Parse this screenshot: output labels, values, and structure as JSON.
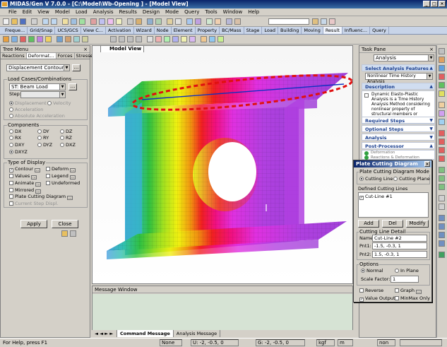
{
  "window": {
    "title": "MIDAS/Gen V 7.0.0 - [C:\\Model\\Wb-Opening ] - [Model View]"
  },
  "menu": [
    "File",
    "Edit",
    "View",
    "Model",
    "Load",
    "Analysis",
    "Results",
    "Design",
    "Mode",
    "Query",
    "Tools",
    "Window",
    "Help"
  ],
  "ribbon_tabs": [
    "Freque...",
    "Grid/Snap",
    "UCS/GCS",
    "View C...",
    "Activation",
    "Wizard",
    "Node",
    "Element",
    "Property",
    "BC/Mass",
    "Stage",
    "Load",
    "Building",
    "Moving",
    "Result",
    "Influenc...",
    "Query"
  ],
  "ribbon_active_tab": "Result",
  "tree_menu": {
    "title": "Tree Menu",
    "tabs": [
      "Reactions",
      "Deformat...",
      "Forces",
      "Stresses"
    ],
    "active_tab": "Deformat...",
    "result_type": "Displacement Contour",
    "load_cases_label": "Load Cases/Combinations",
    "load_case": "ST: Beam Load",
    "step_label": "Step:",
    "displacement": "Displacement",
    "velocity": "Velocity",
    "acceleration": "Acceleration",
    "absolute_acceleration": "Absolute Acceleration",
    "components_label": "Components",
    "components": [
      "DX",
      "DY",
      "DZ",
      "RX",
      "RY",
      "RZ",
      "DXY",
      "DYZ",
      "DXZ",
      "DXYZ"
    ],
    "selected_component": "DXYZ",
    "type_of_display_label": "Type of Display",
    "contour": "Contour",
    "deform": "Deform",
    "values": "Values",
    "legend": "Legend",
    "animate": "Animate",
    "undeformed": "Undeformed",
    "mirrored": "Mirrored",
    "plate_cutting_diagram": "Plate Cutting Diagram",
    "current_step_disp": "Current Step Displ.",
    "apply": "Apply",
    "close": "Close"
  },
  "view": {
    "tab_label": "Model View"
  },
  "task_pane": {
    "title": "Task Pane",
    "dropdown": "Analysis",
    "select_features": "Select Analysis Features",
    "feature": "Nonlinear Time History Analysis",
    "description_label": "Description",
    "description": "Dynamic Elasto-Plastic Analysis is a Time History Analysis Method considering nonlinear property of structural members or boundary conditions.",
    "required_steps": "Required Steps",
    "optional_steps": "Optional Steps",
    "analysis": "Analysis",
    "post_processor": "Post-Processor",
    "post_item_1": "Deformation",
    "post_item_2": "Reactions & Deformation"
  },
  "dialog": {
    "title": "Plate Cutting Diagram",
    "mode_label": "Plate Cutting Diagram Mode",
    "cutting_line": "Cutting Line",
    "cutting_plane": "Cutting Plane",
    "defined_lines_label": "Defined Cutting Lines",
    "defined_lines": [
      "Cut-Line #1"
    ],
    "add": "Add",
    "del": "Del",
    "modify": "Modify",
    "detail_label": "Cutting Line Detail",
    "name_label": "Name:",
    "name_value": "Cut-Line #2",
    "pnt1_label": "Pnt1:",
    "pnt1_value": "-1.5, -0.3, 1",
    "pnt2_label": "Pnt2:",
    "pnt2_value": "1.5, -0.3, 1",
    "options_label": "Options",
    "normal": "Normal",
    "in_plane": "In Plane",
    "scale_label": "Scale Factor:",
    "scale_value": "1",
    "reverse": "Reverse",
    "graph": "Graph",
    "value_output": "Value Output",
    "minmax_only": "MinMax Only"
  },
  "message_window": {
    "title": "Message Window",
    "tabs": [
      "Command Message",
      "Analysis Message"
    ]
  },
  "status": {
    "help": "For Help, press F1",
    "none": "None",
    "u_coord": "U: -2, -0.5, 0",
    "g_coord": "G: -2, -0.5, 0",
    "unit_force": "kgf",
    "unit_length": "m",
    "unit_none": "non"
  },
  "colors": {
    "title_blue": "#0a246a",
    "cut_line_red": "#e01010",
    "task_link": "#1a3f8f"
  }
}
